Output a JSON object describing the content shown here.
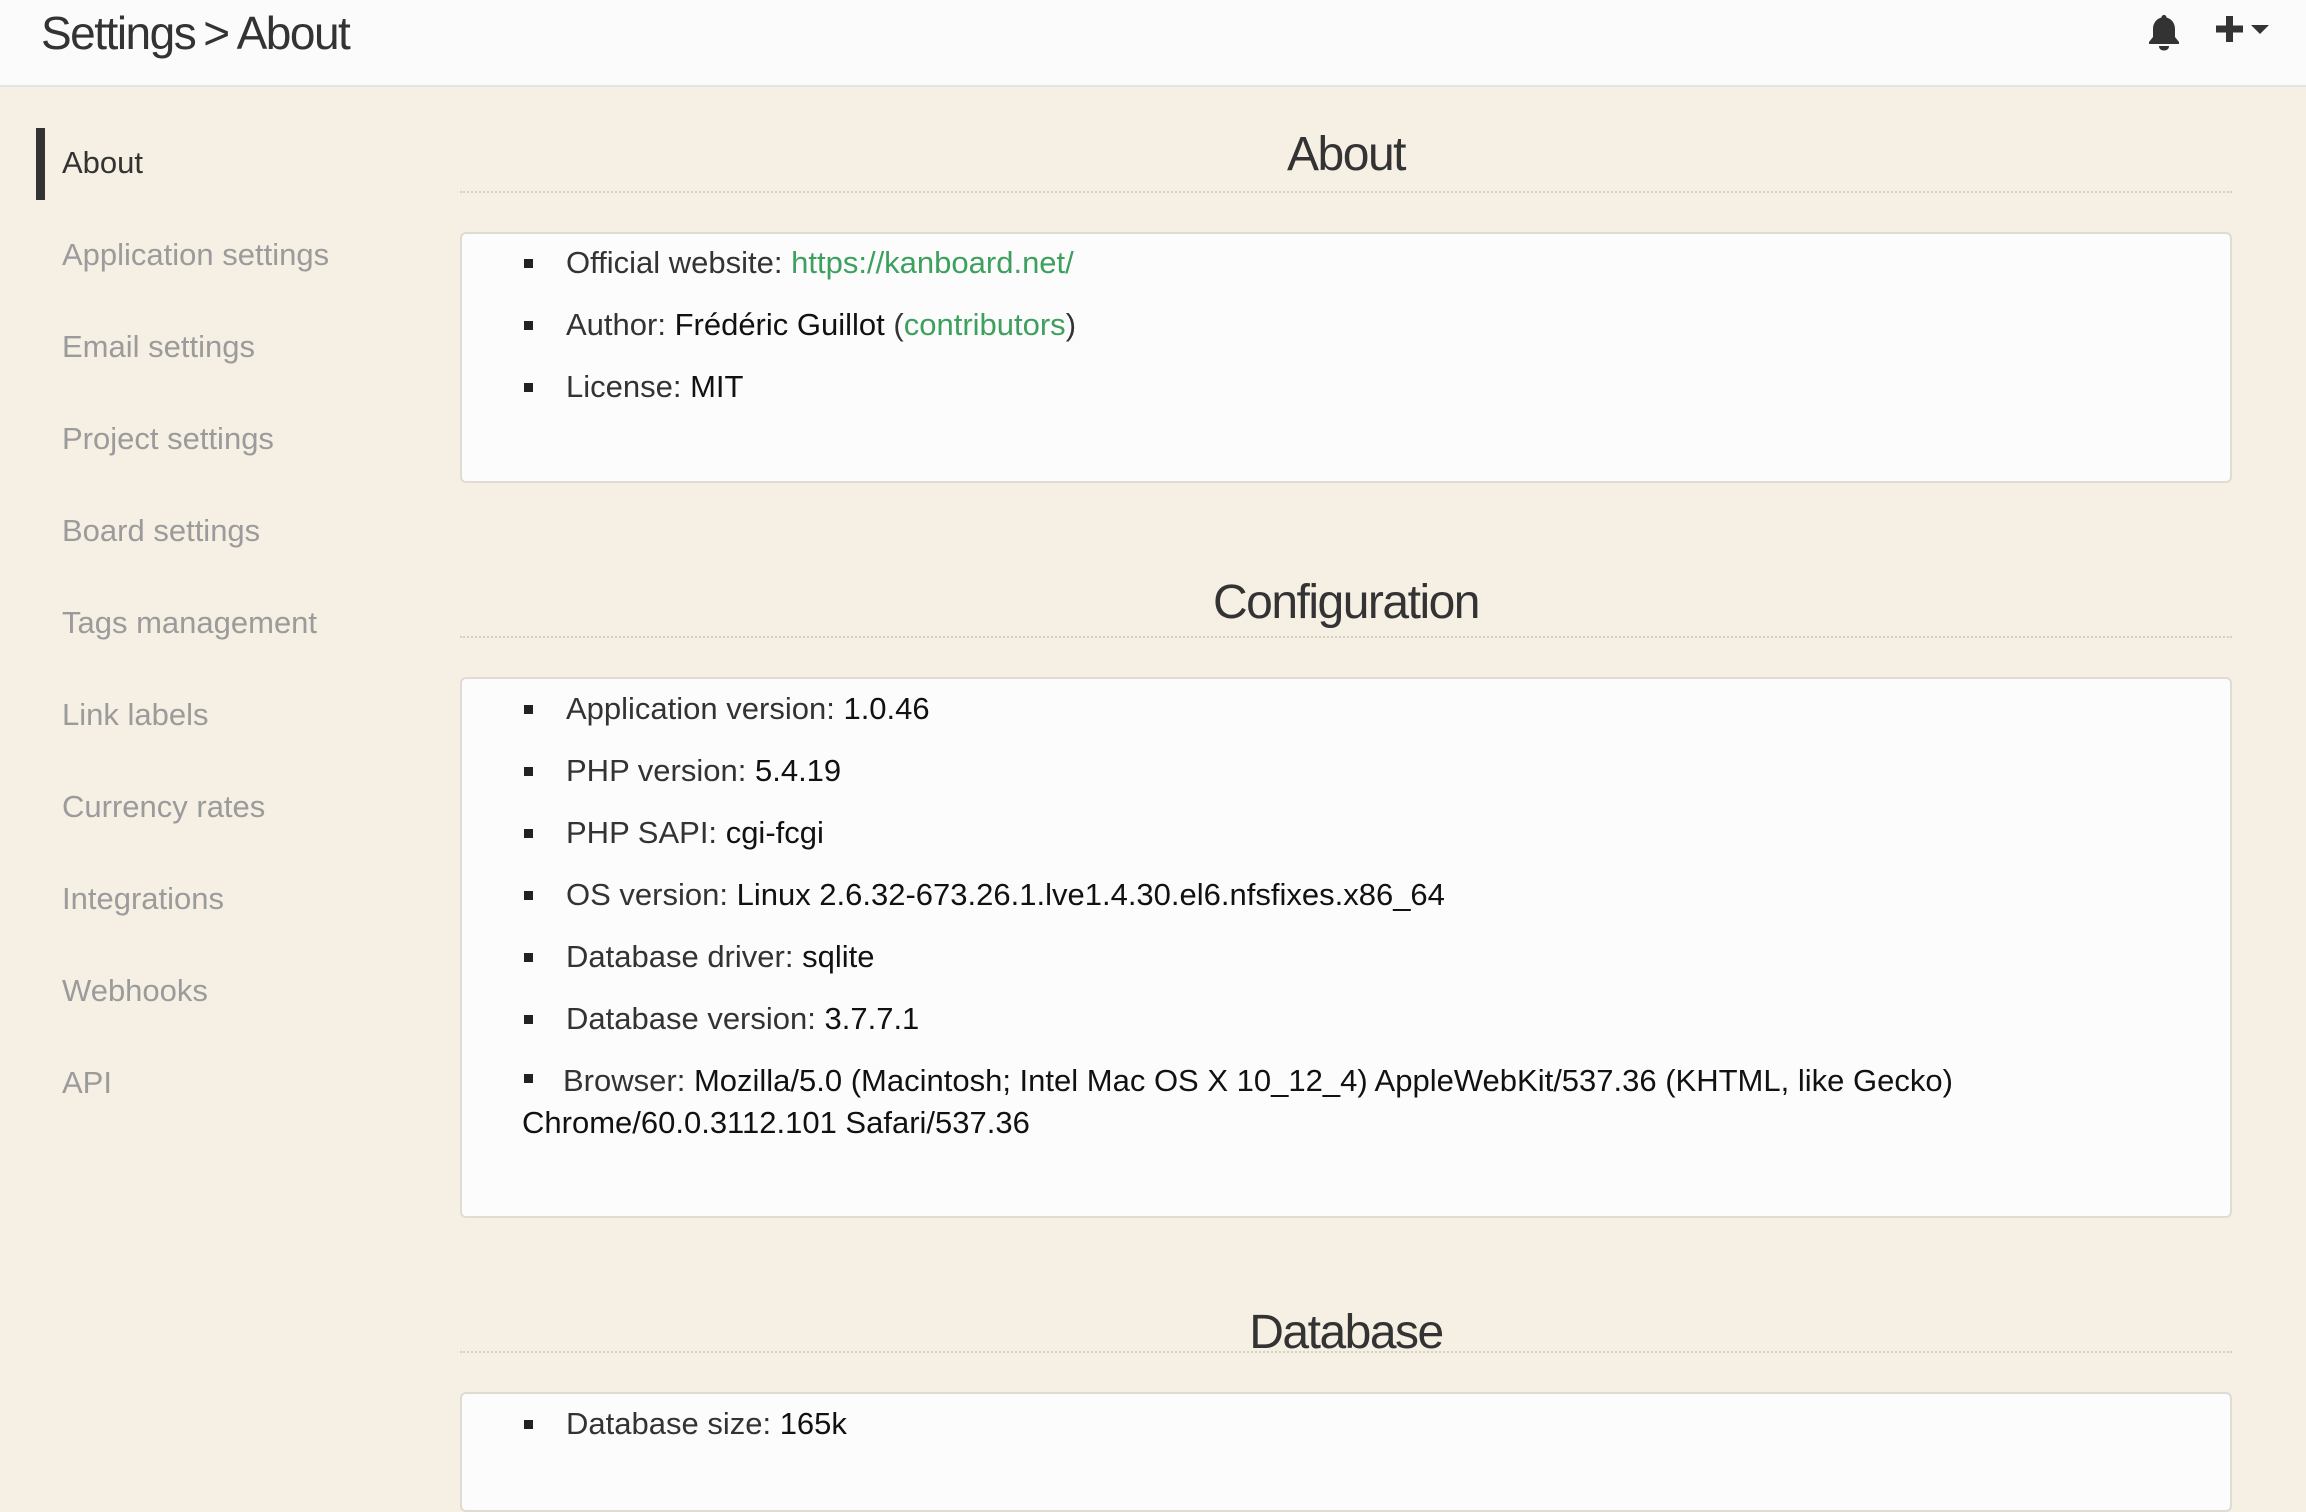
{
  "header": {
    "breadcrumb_parent": "Settings",
    "breadcrumb_separator": ">",
    "breadcrumb_current": "About",
    "icons": [
      "bell-icon",
      "plus-icon",
      "caret-down-icon"
    ]
  },
  "sidebar": {
    "items": [
      {
        "label": "About",
        "active": true
      },
      {
        "label": "Application settings"
      },
      {
        "label": "Email settings"
      },
      {
        "label": "Project settings"
      },
      {
        "label": "Board settings"
      },
      {
        "label": "Tags management"
      },
      {
        "label": "Link labels"
      },
      {
        "label": "Currency rates"
      },
      {
        "label": "Integrations"
      },
      {
        "label": "Webhooks"
      },
      {
        "label": "API"
      }
    ]
  },
  "about": {
    "title": "About",
    "website_label": "Official website:",
    "website_link": "https://kanboard.net/",
    "author_label": "Author:",
    "author_value": "Frédéric Guillot",
    "author_paren_open": "(",
    "contributors_link": "contributors",
    "author_paren_close": ")",
    "license_label": "License:",
    "license_value": "MIT"
  },
  "configuration": {
    "title": "Configuration",
    "items": [
      {
        "label": "Application version:",
        "value": "1.0.46"
      },
      {
        "label": "PHP version:",
        "value": "5.4.19"
      },
      {
        "label": "PHP SAPI:",
        "value": "cgi-fcgi"
      },
      {
        "label": "OS version:",
        "value": "Linux 2.6.32-673.26.1.lve1.4.30.el6.nfsfixes.x86_64"
      },
      {
        "label": "Database driver:",
        "value": "sqlite"
      },
      {
        "label": "Database version:",
        "value": "3.7.7.1"
      }
    ],
    "browser_label": "Browser:",
    "browser_value": "Mozilla/5.0 (Macintosh; Intel Mac OS X 10_12_4) AppleWebKit/537.36 (KHTML, like Gecko) Chrome/60.0.3112.101 Safari/537.36"
  },
  "database": {
    "title": "Database",
    "size_label": "Database size:",
    "size_value": "165k"
  },
  "colors": {
    "background": "#f5efe4",
    "header_bg": "#fbfbfb",
    "link": "#3ea05f",
    "sidebar_inactive": "#9b9b9b",
    "text": "#333333"
  }
}
